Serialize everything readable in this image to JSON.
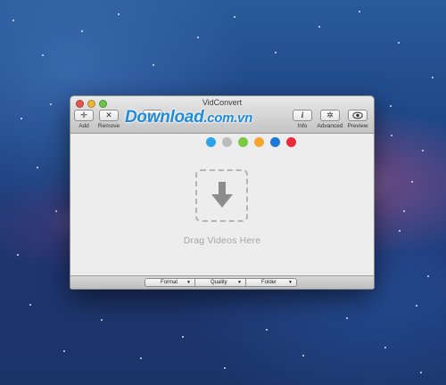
{
  "window": {
    "title": "VidConvert"
  },
  "toolbar": {
    "add_label": "Add",
    "remove_label": "Remove",
    "info_label": "Info",
    "advanced_label": "Advanced",
    "preview_label": "Preview",
    "icons": {
      "add": "plus-icon",
      "remove": "x-icon",
      "play": "play-icon",
      "info": "info-icon",
      "advanced": "gear-icon",
      "preview": "eye-icon"
    }
  },
  "watermark": {
    "brand": "Download",
    "domain": ".com.vn"
  },
  "color_labels": [
    "#2aa3ec",
    "#bcbcbc",
    "#7ac943",
    "#f7a531",
    "#1b7ad6",
    "#ec2b3a"
  ],
  "dropzone": {
    "text": "Drag Videos Here",
    "icon": "download-arrow-icon"
  },
  "bottom": {
    "format_label": "Format",
    "quality_label": "Quality",
    "folder_label": "Folder"
  }
}
